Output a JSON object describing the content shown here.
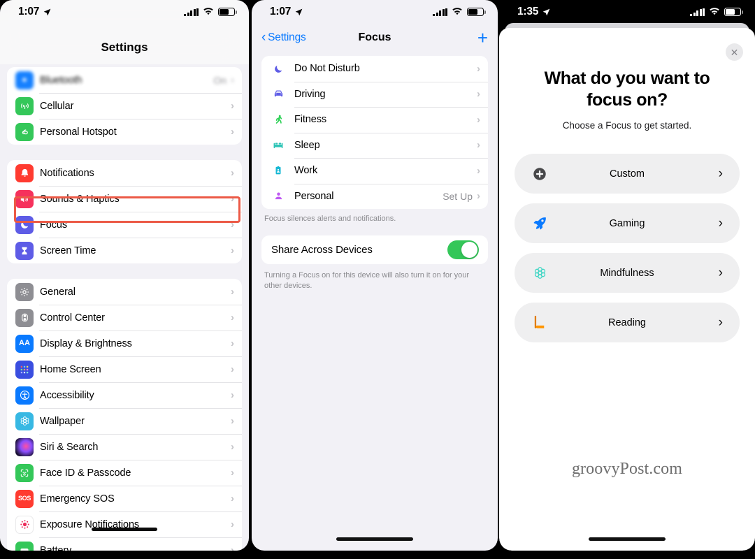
{
  "panels": {
    "settings": {
      "status": {
        "time": "1:07",
        "location_icon": "location-arrow-icon",
        "signal_icon": "cellular-bars-icon",
        "wifi_icon": "wifi-icon",
        "battery_icon": "battery-icon"
      },
      "title": "Settings",
      "groups": [
        {
          "rows": [
            {
              "label": "Bluetooth",
              "value": "On",
              "icon": "bluetooth-icon",
              "color": "#0a7aff",
              "blurred": true
            },
            {
              "label": "Cellular",
              "value": "",
              "icon": "cellular-icon",
              "color": "#34c759",
              "blurred": false
            },
            {
              "label": "Personal Hotspot",
              "value": "",
              "icon": "hotspot-icon",
              "color": "#34c759",
              "blurred": false
            }
          ]
        },
        {
          "rows": [
            {
              "label": "Notifications",
              "value": "",
              "icon": "notifications-bell-icon",
              "color": "#ff3b30",
              "blurred": false
            },
            {
              "label": "Sounds & Haptics",
              "value": "",
              "icon": "speaker-icon",
              "color": "#f6315c",
              "blurred": false
            },
            {
              "label": "Focus",
              "value": "",
              "icon": "moon-icon",
              "color": "#5e5ce6",
              "blurred": false
            },
            {
              "label": "Screen Time",
              "value": "",
              "icon": "hourglass-icon",
              "color": "#5e5ce6",
              "blurred": false
            }
          ]
        },
        {
          "rows": [
            {
              "label": "General",
              "value": "",
              "icon": "gear-icon",
              "color": "#8e8e93",
              "blurred": false
            },
            {
              "label": "Control Center",
              "value": "",
              "icon": "control-center-icon",
              "color": "#8e8e93",
              "blurred": false
            },
            {
              "label": "Display & Brightness",
              "value": "",
              "icon": "display-brightness-icon",
              "color": "#0a7aff",
              "blurred": false
            },
            {
              "label": "Home Screen",
              "value": "",
              "icon": "home-screen-icon",
              "color": "#3a4ee0",
              "blurred": false
            },
            {
              "label": "Accessibility",
              "value": "",
              "icon": "accessibility-icon",
              "color": "#0a7aff",
              "blurred": false
            },
            {
              "label": "Wallpaper",
              "value": "",
              "icon": "wallpaper-icon",
              "color": "#37b8e3",
              "blurred": false
            },
            {
              "label": "Siri & Search",
              "value": "",
              "icon": "siri-icon",
              "color": "#1a1133",
              "blurred": false
            },
            {
              "label": "Face ID & Passcode",
              "value": "",
              "icon": "face-id-icon",
              "color": "#34c759",
              "blurred": false
            },
            {
              "label": "Emergency SOS",
              "value": "",
              "icon": "sos-icon",
              "color": "#ff3b30",
              "blurred": false
            },
            {
              "label": "Exposure Notifications",
              "value": "",
              "icon": "exposure-notifications-icon",
              "color": "#ffffff",
              "blurred": false
            },
            {
              "label": "Battery",
              "value": "",
              "icon": "battery-icon",
              "color": "#34c759",
              "blurred": false
            }
          ]
        }
      ],
      "highlight": {
        "target_label": "Focus",
        "color": "#ec5a47"
      }
    },
    "focus": {
      "status": {
        "time": "1:07"
      },
      "back_label": "Settings",
      "title": "Focus",
      "add_button_label": "+",
      "rows": [
        {
          "label": "Do Not Disturb",
          "value": "",
          "icon": "moon-icon",
          "color": "#5e5ce6"
        },
        {
          "label": "Driving",
          "value": "",
          "icon": "car-icon",
          "color": "#5e5ce6"
        },
        {
          "label": "Fitness",
          "value": "",
          "icon": "running-person-icon",
          "color": "#30d158"
        },
        {
          "label": "Sleep",
          "value": "",
          "icon": "bed-icon",
          "color": "#2ec4b6"
        },
        {
          "label": "Work",
          "value": "",
          "icon": "id-badge-icon",
          "color": "#17b8d4"
        },
        {
          "label": "Personal",
          "value": "Set Up",
          "icon": "person-icon",
          "color": "#bf5af2"
        }
      ],
      "footer": "Focus silences alerts and notifications.",
      "switch": {
        "label": "Share Across Devices",
        "state": "on",
        "color": "#34c759"
      },
      "switch_footer": "Turning a Focus on for this device will also turn it on for your other devices.",
      "annotation": {
        "type": "red-arrow",
        "points_to": "add-focus-button",
        "color": "#ee5e4b"
      }
    },
    "sheet": {
      "status": {
        "time": "1:35"
      },
      "close_label": "✕",
      "heading": "What do you want to focus on?",
      "subheading": "Choose a Focus to get started.",
      "options": [
        {
          "label": "Custom",
          "icon": "plus-circle-icon",
          "color": "#48484a"
        },
        {
          "label": "Gaming",
          "icon": "rocket-icon",
          "color": "#0a7aff"
        },
        {
          "label": "Mindfulness",
          "icon": "mindfulness-flower-icon",
          "color": "#3fd6c4"
        },
        {
          "label": "Reading",
          "icon": "book-icon",
          "color": "#ff9500"
        }
      ],
      "watermark": "groovyPost.com"
    }
  }
}
